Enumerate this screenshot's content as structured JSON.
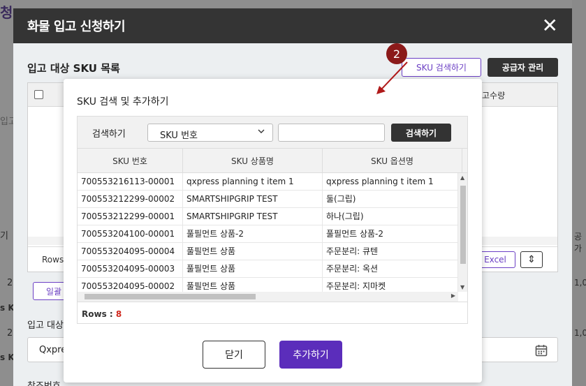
{
  "background": {
    "page_title_fragment": "청",
    "left_fragments": [
      "입고",
      "기",
      "2(",
      "s Kl",
      "2(",
      "s Kl"
    ],
    "right_fragments": [
      "고수량",
      "1,0",
      "1,0",
      "공가"
    ],
    "row_fragments": [
      "2(",
      "2("
    ]
  },
  "modal": {
    "title": "화물 입고 신청하기",
    "section_title": "입고 대상 SKU 목록",
    "sku_search_button": "SKU 검색하기",
    "supplier_button": "공급자 관리",
    "table": {
      "stock_column_fragment": "고수량",
      "rows_label": "Rows",
      "excel_button": "Excel"
    },
    "bulk_button": "일괄",
    "target_label": "입고 대상",
    "target_value": "Qxpres",
    "ref_label": "참조번호"
  },
  "annotation": {
    "step": "2"
  },
  "sku_dialog": {
    "title": "SKU 검색 및 추가하기",
    "search_label": "검색하기",
    "search_type_selected": "SKU 번호",
    "search_input_value": "",
    "search_button": "검색하기",
    "columns": [
      "SKU 번호",
      "SKU 상품명",
      "SKU 옵션명"
    ],
    "rows": [
      [
        "700553216113-00001",
        "qxpress planning t item 1",
        "qxpress planning t item 1"
      ],
      [
        "700553212299-00002",
        "SMARTSHIPGRIP TEST",
        "둘(그립)"
      ],
      [
        "700553212299-00001",
        "SMARTSHIPGRIP TEST",
        "하나(그립)"
      ],
      [
        "700553204100-00001",
        "풀필먼트 상품-2",
        "풀필먼트 상품-2"
      ],
      [
        "700553204095-00004",
        "풀필먼트 상품",
        "주문분리: 큐텐"
      ],
      [
        "700553204095-00003",
        "풀필먼트 상품",
        "주문분리: 옥션"
      ],
      [
        "700553204095-00002",
        "풀필먼트 상품",
        "주문분리: 지마켓"
      ]
    ],
    "rows_label": "Rows : ",
    "rows_count": "8",
    "close_button": "닫기",
    "add_button": "추가하기"
  },
  "colors": {
    "accent": "#5b2dbb",
    "header": "#343434",
    "badge": "#8b1a1a",
    "rows_count": "#d0281e"
  }
}
